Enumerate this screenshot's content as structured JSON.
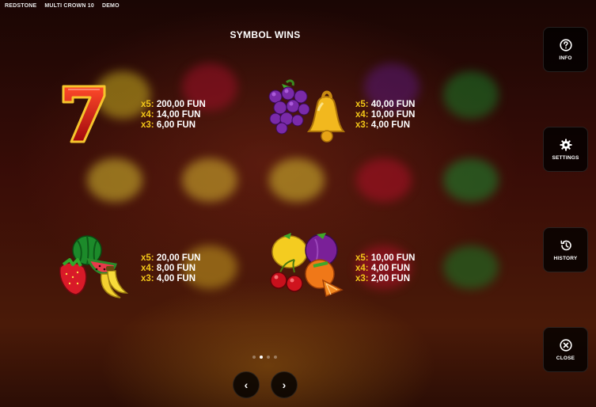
{
  "topbar": {
    "brand": "REDSTONE",
    "game": "MULTI CROWN 10",
    "mode": "DEMO"
  },
  "title": "SYMBOL WINS",
  "symbols": [
    {
      "icon": "seven-icon",
      "wins": [
        {
          "mult": "x5:",
          "value": "200,00 FUN"
        },
        {
          "mult": "x4:",
          "value": "14,00 FUN"
        },
        {
          "mult": "x3:",
          "value": "6,00 FUN"
        }
      ]
    },
    {
      "icon": "grapes-bell-icon",
      "wins": [
        {
          "mult": "x5:",
          "value": "40,00 FUN"
        },
        {
          "mult": "x4:",
          "value": "10,00 FUN"
        },
        {
          "mult": "x3:",
          "value": "4,00 FUN"
        }
      ]
    },
    {
      "icon": "watermelon-strawberry-banana-icon",
      "wins": [
        {
          "mult": "x5:",
          "value": "20,00 FUN"
        },
        {
          "mult": "x4:",
          "value": "8,00 FUN"
        },
        {
          "mult": "x3:",
          "value": "4,00 FUN"
        }
      ]
    },
    {
      "icon": "lemon-plum-cherry-orange-icon",
      "wins": [
        {
          "mult": "x5:",
          "value": "10,00 FUN"
        },
        {
          "mult": "x4:",
          "value": "4,00 FUN"
        },
        {
          "mult": "x3:",
          "value": "2,00 FUN"
        }
      ]
    }
  ],
  "side_buttons": {
    "info": "INFO",
    "settings": "SETTINGS",
    "history": "HISTORY",
    "close": "CLOSE"
  },
  "pager": {
    "pages": 4,
    "active": 2
  },
  "nav": {
    "prev": "‹",
    "next": "›"
  },
  "colors": {
    "multiplier": "#f2c618",
    "button_bg": "#000000"
  }
}
